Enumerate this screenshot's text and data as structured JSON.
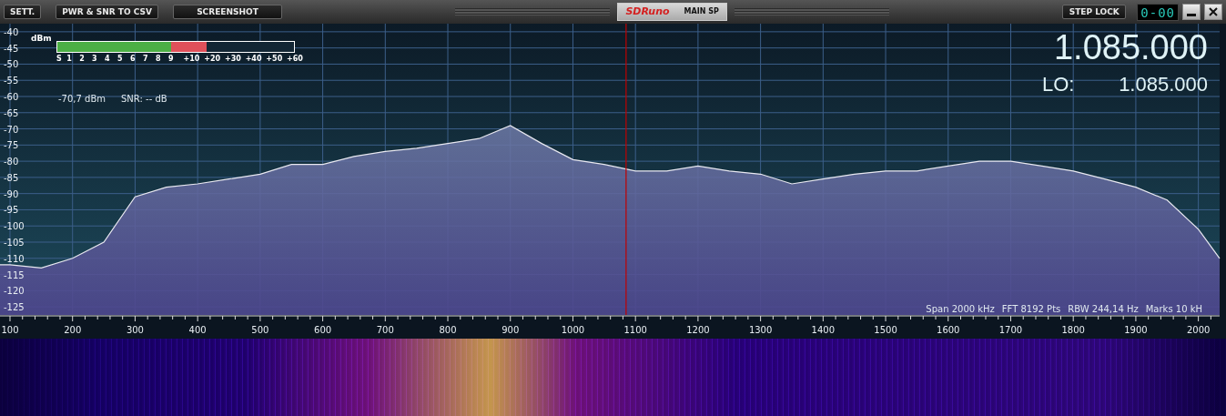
{
  "toolbar": {
    "buttons": [
      "SETT.",
      "PWR & SNR TO CSV",
      "SCREENSHOT"
    ],
    "logo": "SDRuno",
    "panel_title": "MAIN SP",
    "step_lock": "STEP LOCK",
    "step_display": "0-00"
  },
  "smeter": {
    "unit": "dBm",
    "scale": [
      "S",
      "1",
      "2",
      "3",
      "4",
      "5",
      "6",
      "7",
      "8",
      "9",
      "+10",
      "+20",
      "+30",
      "+40",
      "+50",
      "+60"
    ],
    "level": 0.63,
    "reading": "-70,7 dBm",
    "snr": "SNR: -- dB"
  },
  "frequency": {
    "main": "1.085.000",
    "lo_label": "LO:",
    "lo_value": "1.085.000"
  },
  "spectrum": {
    "chart_data": {
      "type": "area",
      "x": [
        84,
        100,
        150,
        200,
        250,
        300,
        350,
        400,
        450,
        500,
        550,
        600,
        650,
        700,
        750,
        800,
        850,
        900,
        950,
        1000,
        1050,
        1100,
        1150,
        1200,
        1250,
        1300,
        1350,
        1400,
        1450,
        1500,
        1550,
        1600,
        1650,
        1700,
        1750,
        1800,
        1850,
        1900,
        1950,
        2000,
        2034
      ],
      "series": [
        {
          "color": "#e8e8f0",
          "values": [
            -112,
            -112,
            -113,
            -110,
            -105,
            -91,
            -88,
            -87,
            -85.5,
            -84,
            -81,
            -81,
            -78.5,
            -77,
            -76,
            -74.5,
            -73,
            -69,
            -74.5,
            -79.5,
            -81,
            -83,
            -83,
            -81.5,
            -83,
            -84,
            -87,
            -85.5,
            -84,
            -83,
            -83,
            -81.5,
            -80,
            -80,
            -81.5,
            -83,
            -85.5,
            -88,
            -92,
            -101,
            -110
          ]
        }
      ],
      "xlim": [
        84,
        2034
      ],
      "ylim": [
        -127.5,
        -37.5
      ],
      "xticks": [
        100,
        200,
        300,
        400,
        500,
        600,
        700,
        800,
        900,
        1000,
        1100,
        1200,
        1300,
        1400,
        1500,
        1600,
        1700,
        1800,
        1900,
        2000
      ],
      "yticks": [
        -40,
        -45,
        -50,
        -55,
        -60,
        -65,
        -70,
        -75,
        -80,
        -85,
        -90,
        -95,
        -100,
        -105,
        -110,
        -115,
        -120,
        -125
      ],
      "grid": true,
      "ref_lines": [
        {
          "axis": "x",
          "value": 1085,
          "color": "#c00000"
        }
      ]
    },
    "info": [
      "Span 2000 kHz",
      "FFT 8192 Pts",
      "RBW 244,14 Hz",
      "Marks 10 kH"
    ]
  }
}
